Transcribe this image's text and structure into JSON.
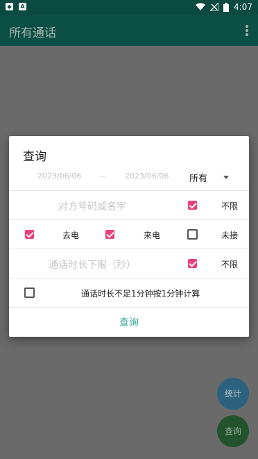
{
  "status": {
    "time": "4:07"
  },
  "appbar": {
    "title": "所有通话"
  },
  "dialog": {
    "title": "查询",
    "date_from": "2023/06/06",
    "date_sep": "--",
    "date_to": "2023/06/06",
    "type_select": "所有",
    "name_placeholder": "对方号码或名字",
    "unlimited": "不限",
    "outgoing": "去电",
    "incoming": "来电",
    "missed": "未接",
    "duration_placeholder": "通话时长下限（秒）",
    "round_up": "通话时长不足1分钟按1分钟计算",
    "query_button": "查询",
    "checks": {
      "name_unlimited": true,
      "outgoing": true,
      "incoming": true,
      "missed": false,
      "duration_unlimited": true,
      "round_up": false
    }
  },
  "fabs": {
    "stats": "统计",
    "query": "查询"
  },
  "colors": {
    "accent": "#ec407a",
    "teal": "#3ea99a",
    "appbar": "#0c4f44"
  },
  "icons": [
    "shield-icon",
    "text-icon",
    "wifi-icon",
    "signal-off-icon",
    "battery-icon",
    "more-vert-icon",
    "dropdown-caret-icon"
  ]
}
